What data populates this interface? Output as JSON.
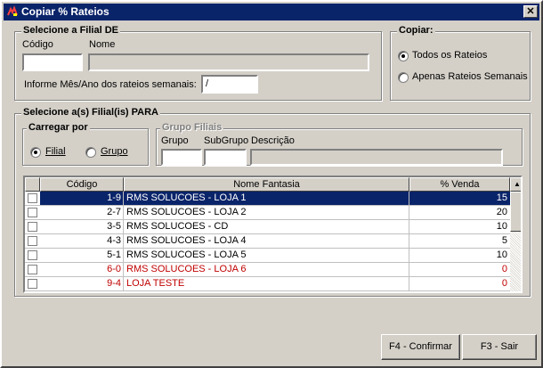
{
  "window": {
    "title": "Copiar % Rateios",
    "close_label": "✕"
  },
  "filial_de": {
    "legend": "Selecione a Filial DE",
    "codigo_label": "Código",
    "nome_label": "Nome",
    "codigo_value": "",
    "nome_value": "",
    "mes_ano_label": "Informe Mês/Ano dos rateios semanais:",
    "mes_ano_value": " /"
  },
  "copiar": {
    "legend": "Copiar:",
    "options": [
      {
        "label": "Todos os Rateios",
        "checked": true
      },
      {
        "label": "Apenas Rateios Semanais",
        "checked": false
      }
    ]
  },
  "filial_para": {
    "legend": "Selecione a(s) Filial(is) PARA",
    "carregar_por": {
      "legend": "Carregar por",
      "filial_label": "Filial",
      "grupo_label": "Grupo",
      "selected": "Filial"
    },
    "grupo_filiais": {
      "legend": "Grupo Filiais",
      "grupo_label": "Grupo",
      "subgrupo_label": "SubGrupo",
      "descricao_label": "Descrição"
    }
  },
  "table": {
    "columns": [
      "",
      "Código",
      "Nome Fantasia",
      "% Venda"
    ],
    "rows": [
      {
        "codigo": "1-9",
        "nome": "RMS SOLUCOES - LOJA 1",
        "venda": "15",
        "state": "selected"
      },
      {
        "codigo": "2-7",
        "nome": "RMS SOLUCOES - LOJA 2",
        "venda": "20",
        "state": "normal"
      },
      {
        "codigo": "3-5",
        "nome": "RMS SOLUCOES - CD",
        "venda": "10",
        "state": "normal"
      },
      {
        "codigo": "4-3",
        "nome": "RMS SOLUCOES - LOJA 4",
        "venda": "5",
        "state": "normal"
      },
      {
        "codigo": "5-1",
        "nome": "RMS SOLUCOES - LOJA 5",
        "venda": "10",
        "state": "normal"
      },
      {
        "codigo": "6-0",
        "nome": "RMS SOLUCOES - LOJA 6",
        "venda": "0",
        "state": "red"
      },
      {
        "codigo": "9-4",
        "nome": "LOJA TESTE",
        "venda": "0",
        "state": "red"
      }
    ]
  },
  "buttons": {
    "confirmar": "F4 - Confirmar",
    "sair": "F3 - Sair"
  },
  "colors": {
    "titlebar": "#0a246a",
    "selection": "#0a246a",
    "inactive_row_text": "#c00000"
  }
}
